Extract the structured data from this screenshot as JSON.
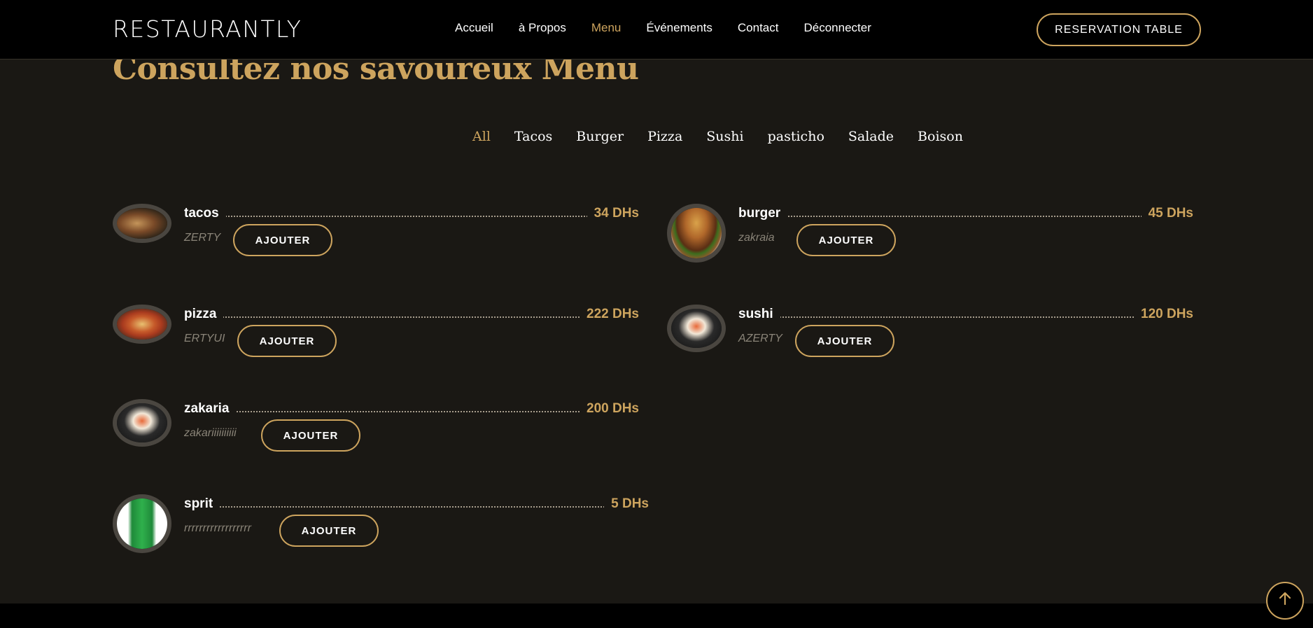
{
  "header": {
    "logo": "RESTAURANTLY",
    "nav": [
      "Accueil",
      "à Propos",
      "Menu",
      "Événements",
      "Contact",
      "Déconnecter"
    ],
    "active_nav": "Menu",
    "reserve_label": "RESERVATION TABLE"
  },
  "section": {
    "title": "Consultez nos savoureux Menu"
  },
  "filters": {
    "items": [
      "All",
      "Tacos",
      "Burger",
      "Pizza",
      "Sushi",
      "pasticho",
      "Salade",
      "Boison"
    ],
    "active": "All"
  },
  "menu": {
    "add_label": "AJOUTER",
    "items": [
      {
        "name": "tacos",
        "desc": "ZERTY",
        "price": "34 DHs",
        "image": "tacos-image"
      },
      {
        "name": "burger",
        "desc": "zakraia",
        "price": "45 DHs",
        "image": "burger-image"
      },
      {
        "name": "pizza",
        "desc": "ERTYUI",
        "price": "222 DHs",
        "image": "pizza-image"
      },
      {
        "name": "sushi",
        "desc": "AZERTY",
        "price": "120 DHs",
        "image": "sushi-image"
      },
      {
        "name": "zakaria",
        "desc": "zakariiiiiiiiii",
        "price": "200 DHs",
        "image": "sushi-image"
      },
      {
        "name": "sprit",
        "desc": "rrrrrrrrrrrrrrrrrr",
        "price": "5 DHs",
        "image": "sprite-can-image"
      }
    ]
  },
  "colors": {
    "accent": "#cda45e",
    "background": "#1a1814",
    "header": "#000000"
  },
  "back_to_top_icon": "arrow-up-icon"
}
